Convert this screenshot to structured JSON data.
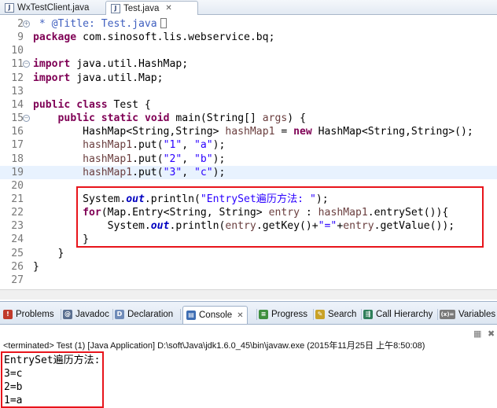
{
  "editor_tabs": [
    {
      "label": "WxTestClient.java",
      "active": false
    },
    {
      "label": "Test.java",
      "active": true
    }
  ],
  "code_lines": [
    {
      "n": "2",
      "fold": "+",
      "segs": [
        {
          "t": " * ",
          "c": "cmt"
        },
        {
          "t": "@Title",
          "c": "cmt"
        },
        {
          "t": ": Test.java",
          "c": "cmt"
        }
      ],
      "cursor": true
    },
    {
      "n": "9",
      "segs": [
        {
          "t": "package",
          "c": "kw"
        },
        {
          "t": " com.sinosoft.lis.webservice.bq;",
          "c": ""
        }
      ]
    },
    {
      "n": "10",
      "segs": []
    },
    {
      "n": "11",
      "fold": "-",
      "segs": [
        {
          "t": "import",
          "c": "kw"
        },
        {
          "t": " java.util.HashMap;",
          "c": ""
        }
      ]
    },
    {
      "n": "12",
      "segs": [
        {
          "t": "import",
          "c": "kw"
        },
        {
          "t": " java.util.Map;",
          "c": ""
        }
      ]
    },
    {
      "n": "13",
      "segs": []
    },
    {
      "n": "14",
      "segs": [
        {
          "t": "public",
          "c": "kw"
        },
        {
          "t": " ",
          "c": ""
        },
        {
          "t": "class",
          "c": "kw"
        },
        {
          "t": " Test {",
          "c": ""
        }
      ]
    },
    {
      "n": "15",
      "fold": "-",
      "segs": [
        {
          "t": "    ",
          "c": ""
        },
        {
          "t": "public",
          "c": "kw"
        },
        {
          "t": " ",
          "c": ""
        },
        {
          "t": "static",
          "c": "kw"
        },
        {
          "t": " ",
          "c": ""
        },
        {
          "t": "void",
          "c": "kw"
        },
        {
          "t": " main(String[] ",
          "c": ""
        },
        {
          "t": "args",
          "c": "var"
        },
        {
          "t": ") {",
          "c": ""
        }
      ]
    },
    {
      "n": "16",
      "segs": [
        {
          "t": "        HashMap<String,String> ",
          "c": ""
        },
        {
          "t": "hashMap1",
          "c": "var"
        },
        {
          "t": " = ",
          "c": ""
        },
        {
          "t": "new",
          "c": "kw"
        },
        {
          "t": " HashMap<String,String>();",
          "c": ""
        }
      ]
    },
    {
      "n": "17",
      "segs": [
        {
          "t": "        ",
          "c": ""
        },
        {
          "t": "hashMap1",
          "c": "var"
        },
        {
          "t": ".put(",
          "c": ""
        },
        {
          "t": "\"1\"",
          "c": "str"
        },
        {
          "t": ", ",
          "c": ""
        },
        {
          "t": "\"a\"",
          "c": "str"
        },
        {
          "t": ");",
          "c": ""
        }
      ]
    },
    {
      "n": "18",
      "segs": [
        {
          "t": "        ",
          "c": ""
        },
        {
          "t": "hashMap1",
          "c": "var"
        },
        {
          "t": ".put(",
          "c": ""
        },
        {
          "t": "\"2\"",
          "c": "str"
        },
        {
          "t": ", ",
          "c": ""
        },
        {
          "t": "\"b\"",
          "c": "str"
        },
        {
          "t": ");",
          "c": ""
        }
      ]
    },
    {
      "n": "19",
      "current": true,
      "segs": [
        {
          "t": "        ",
          "c": ""
        },
        {
          "t": "hashMap1",
          "c": "var"
        },
        {
          "t": ".put(",
          "c": ""
        },
        {
          "t": "\"3\"",
          "c": "str"
        },
        {
          "t": ", ",
          "c": ""
        },
        {
          "t": "\"c\"",
          "c": "str"
        },
        {
          "t": ");",
          "c": ""
        }
      ]
    },
    {
      "n": "20",
      "segs": []
    },
    {
      "n": "21",
      "segs": [
        {
          "t": "        System.",
          "c": ""
        },
        {
          "t": "out",
          "c": "fld"
        },
        {
          "t": ".println(",
          "c": ""
        },
        {
          "t": "\"EntrySet遍历方法: \"",
          "c": "str"
        },
        {
          "t": ");",
          "c": ""
        }
      ]
    },
    {
      "n": "22",
      "segs": [
        {
          "t": "        ",
          "c": ""
        },
        {
          "t": "for",
          "c": "kw"
        },
        {
          "t": "(Map.Entry<String, String> ",
          "c": ""
        },
        {
          "t": "entry",
          "c": "var"
        },
        {
          "t": " : ",
          "c": ""
        },
        {
          "t": "hashMap1",
          "c": "var"
        },
        {
          "t": ".entrySet()){",
          "c": ""
        }
      ]
    },
    {
      "n": "23",
      "segs": [
        {
          "t": "            System.",
          "c": ""
        },
        {
          "t": "out",
          "c": "fld"
        },
        {
          "t": ".println(",
          "c": ""
        },
        {
          "t": "entry",
          "c": "var"
        },
        {
          "t": ".getKey()+",
          "c": ""
        },
        {
          "t": "\"=\"",
          "c": "str"
        },
        {
          "t": "+",
          "c": ""
        },
        {
          "t": "entry",
          "c": "var"
        },
        {
          "t": ".getValue());",
          "c": ""
        }
      ]
    },
    {
      "n": "24",
      "segs": [
        {
          "t": "        }",
          "c": ""
        }
      ]
    },
    {
      "n": "25",
      "segs": [
        {
          "t": "    }",
          "c": ""
        }
      ]
    },
    {
      "n": "26",
      "segs": [
        {
          "t": "}",
          "c": ""
        }
      ]
    },
    {
      "n": "27",
      "segs": []
    }
  ],
  "view_tabs": [
    {
      "label": "Problems",
      "icon": "problems-icon",
      "glyph": "!",
      "color": "#c0392b"
    },
    {
      "label": "Javadoc",
      "icon": "javadoc-icon",
      "glyph": "@",
      "color": "#5a6f90"
    },
    {
      "label": "Declaration",
      "icon": "declaration-icon",
      "glyph": "D",
      "color": "#6f8bb8"
    },
    {
      "label": "Console",
      "icon": "console-icon",
      "glyph": "▤",
      "color": "#3d6db3",
      "active": true
    },
    {
      "label": "Progress",
      "icon": "progress-icon",
      "glyph": "≡",
      "color": "#3f8f3f"
    },
    {
      "label": "Search",
      "icon": "search-icon",
      "glyph": "✎",
      "color": "#c9a227"
    },
    {
      "label": "Call Hierarchy",
      "icon": "call-hierarchy-icon",
      "glyph": "⇶",
      "color": "#2f7f5a"
    },
    {
      "label": "Variables",
      "icon": "variables-icon",
      "glyph": "(x)=",
      "color": "#7a7a7a"
    }
  ],
  "console": {
    "terminated": "<terminated> Test (1) [Java Application] D:\\soft\\Java\\jdk1.6.0_45\\bin\\javaw.exe (2015年11月25日 上午8:50:08)",
    "output": [
      "EntrySet遍历方法: ",
      "3=c",
      "2=b",
      "1=a"
    ]
  },
  "colors": {
    "highlight_box": "#e8141b",
    "keyword": "#7f0055",
    "string": "#2a00ff"
  }
}
